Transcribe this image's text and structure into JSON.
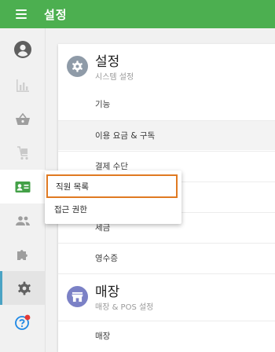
{
  "colors": {
    "topbar": "#4caf50",
    "accent_rail": "#4aa3c4",
    "settings_icon_bg": "#8f9ba8",
    "store_icon_bg": "#7b81c6",
    "highlight_border": "#e07a22",
    "badge": "#e53935"
  },
  "header": {
    "title": "설정",
    "menu_icon": "hamburger-menu-icon"
  },
  "rail": {
    "items": [
      {
        "name": "account",
        "icon": "account-circle-icon"
      },
      {
        "name": "reports",
        "icon": "bar-chart-icon"
      },
      {
        "name": "items",
        "icon": "basket-icon"
      },
      {
        "name": "inventory",
        "icon": "cart-icon"
      },
      {
        "name": "employees",
        "icon": "badge-card-icon"
      },
      {
        "name": "customers",
        "icon": "people-icon"
      },
      {
        "name": "integrations",
        "icon": "puzzle-icon"
      },
      {
        "name": "settings",
        "icon": "gear-icon"
      },
      {
        "name": "help",
        "icon": "help-icon"
      }
    ]
  },
  "settings_section": {
    "title": "설정",
    "subtitle": "시스템 설정",
    "rows": [
      "기능",
      "이용 요금 & 구독",
      "결제 수단",
      "",
      "세금",
      "영수증"
    ]
  },
  "store_section": {
    "title": "매장",
    "subtitle": "매장 & POS 설정",
    "rows": [
      "매장"
    ]
  },
  "employee_menu": {
    "items": [
      "직원 목록",
      "접근 권한"
    ]
  }
}
